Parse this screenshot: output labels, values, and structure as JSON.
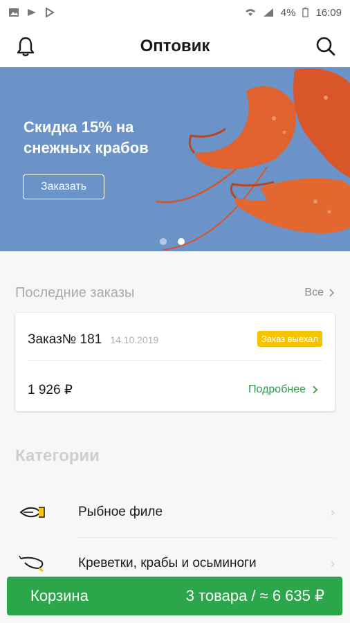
{
  "status_bar": {
    "battery": "4%",
    "time": "16:09"
  },
  "header": {
    "title": "Оптовик",
    "left_icon": "bell-icon",
    "right_icon": "search-icon"
  },
  "banner": {
    "text": "Скидка 15% на снежных крабов",
    "button_label": "Заказать",
    "background_color": "#6b93c7",
    "slides_count": 2,
    "active_slide": 2
  },
  "last_orders": {
    "heading": "Последние заказы",
    "all_label": "Все",
    "order": {
      "number": "Заказ№ 181",
      "date": "14.10.2019",
      "status": "Заказ выехал",
      "status_color": "#f5c400",
      "price": "1 926 ₽",
      "details_label": "Подробнее",
      "details_color": "#2f9b4b"
    }
  },
  "categories": {
    "heading": "Категории",
    "items": [
      {
        "label": "Рыбное филе",
        "icon": "fish-fillet-icon"
      },
      {
        "label": "Креветки, крабы и осьминоги",
        "icon": "shrimp-icon"
      }
    ]
  },
  "cart": {
    "label": "Корзина",
    "summary": "3 товара / ≈ 6 635 ₽",
    "color": "#2ca64a"
  }
}
